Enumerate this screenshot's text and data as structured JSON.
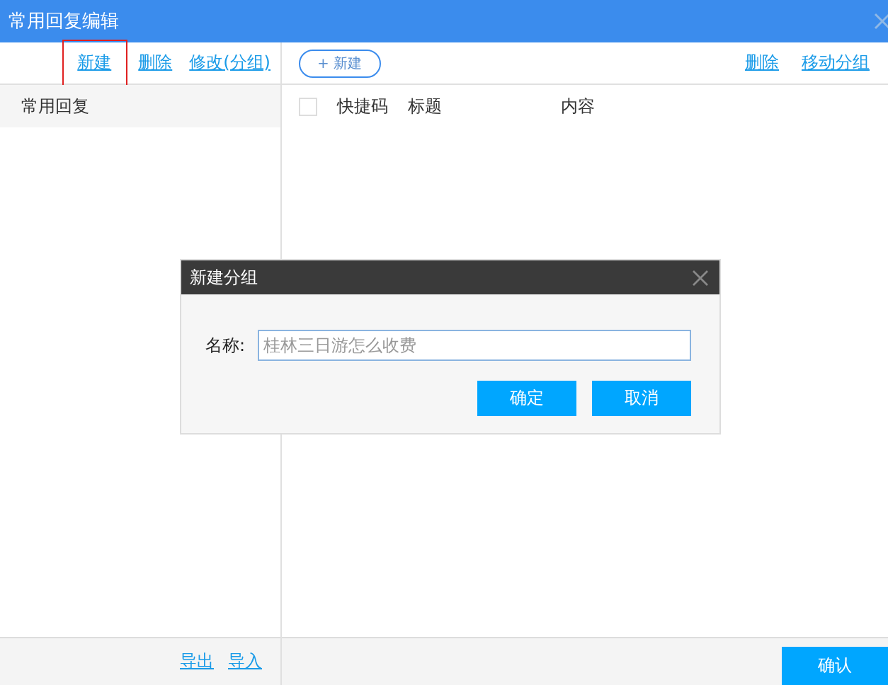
{
  "window": {
    "title": "常用回复编辑"
  },
  "left_toolbar": [
    {
      "label": "新建",
      "highlighted": true
    },
    {
      "label": "删除",
      "highlighted": false
    },
    {
      "label": "修改(分组)",
      "highlighted": false
    }
  ],
  "right_toolbar": {
    "new_button": "+ 新建",
    "links": [
      "删除",
      "移动分组"
    ]
  },
  "left_panel": {
    "header": "常用回复"
  },
  "table": {
    "select_all_checked": false,
    "columns": [
      "快捷码",
      "标题",
      "内容"
    ]
  },
  "bottom_links": [
    "导出",
    "导入"
  ],
  "confirm_button": "确认",
  "dialog": {
    "title": "新建分组",
    "field_label": "名称:",
    "placeholder": "桂林三日游怎么收费",
    "buttons": [
      "确定",
      "取消"
    ]
  }
}
